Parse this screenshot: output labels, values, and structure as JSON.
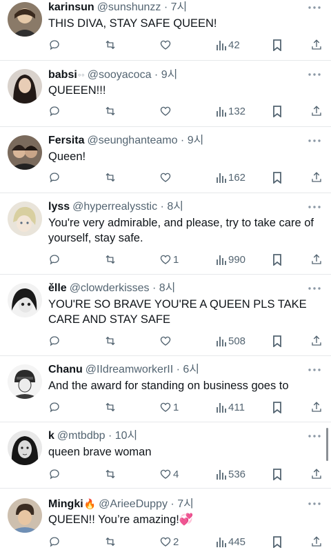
{
  "tweets": [
    {
      "name": "karinsun",
      "emoji": "",
      "handle": "@sunshunzz",
      "dot": "·",
      "time": "7시",
      "text": "THIS DIVA, STAY SAFE QUEEN!",
      "likes": "",
      "views": "42",
      "avatar_color": "#6d5a47"
    },
    {
      "name": "babsi",
      "emoji": "◦◦",
      "handle": "@sooyacoca",
      "dot": "·",
      "time": "9시",
      "text": "QUEEEN!!!",
      "likes": "",
      "views": "132",
      "avatar_color": "#3a2e2a"
    },
    {
      "name": "Fersita",
      "emoji": "",
      "handle": "@seunghanteamo",
      "dot": "·",
      "time": "9시",
      "text": "Queen!",
      "likes": "",
      "views": "162",
      "avatar_color": "#5c4a3d"
    },
    {
      "name": "lyss",
      "emoji": "",
      "handle": "@hyperrealysstic",
      "dot": "·",
      "time": "8시",
      "text": "You're very admirable, and please, try to take care of yourself, stay safe.",
      "likes": "1",
      "views": "990",
      "avatar_color": "#c9c3b6"
    },
    {
      "name": "ělle",
      "emoji": "",
      "handle": "@clowderkisses",
      "dot": "·",
      "time": "8시",
      "text": "YOU'RE SO BRAVE YOU'RE A QUEEN PLS TAKE CARE AND STAY SAFE",
      "likes": "",
      "views": "508",
      "avatar_color": "#9a9a9a"
    },
    {
      "name": "Chanu",
      "emoji": "",
      "handle": "@IIdreamworkerII",
      "dot": "·",
      "time": "6시",
      "text": "And the award for standing on business goes to",
      "likes": "1",
      "views": "411",
      "avatar_color": "#4a4a4a"
    },
    {
      "name": "k",
      "emoji": "",
      "handle": "@mtbdbp",
      "dot": "·",
      "time": "10시",
      "text": "queen brave woman",
      "likes": "4",
      "views": "536",
      "avatar_color": "#d8d8d8"
    },
    {
      "name": "Mingki",
      "emoji": "🔥",
      "handle": "@ArieeDuppy",
      "dot": "·",
      "time": "7시",
      "text": "QUEEN!! You’re amazing!💞",
      "likes": "2",
      "views": "445",
      "avatar_color": "#a88a6a"
    }
  ],
  "icons": {
    "more": "more-icon",
    "reply": "reply-icon",
    "retweet": "retweet-icon",
    "like": "heart-icon",
    "views": "views-icon",
    "bookmark": "bookmark-icon",
    "share": "share-icon"
  },
  "colors": {
    "text": "#0f1419",
    "secondary": "#536471",
    "divider": "#e6e8ea",
    "background": "#ffffff"
  }
}
